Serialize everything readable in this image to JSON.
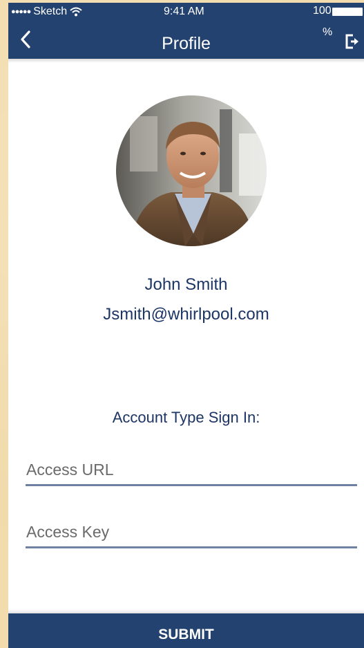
{
  "status_bar": {
    "signal": "●●●●●",
    "carrier": "Sketch",
    "time": "9:41 AM",
    "battery_value": "100",
    "battery_percent_sign": "%"
  },
  "header": {
    "title": "Profile",
    "back_icon": "chevron-left-icon",
    "logout_icon": "logout-icon",
    "background": "#24426f"
  },
  "profile": {
    "name": "John Smith",
    "email": "Jsmith@whirlpool.com"
  },
  "form": {
    "section_label": "Account Type Sign In:",
    "access_url": {
      "value": "",
      "placeholder": "Access URL"
    },
    "access_key": {
      "value": "",
      "placeholder": "Access Key"
    },
    "submit_label": "SUBMIT"
  },
  "colors": {
    "accent": "#24426f",
    "text": "#1d3564",
    "field_underline": "#6f80a3",
    "page_background": "#f2dcae"
  }
}
